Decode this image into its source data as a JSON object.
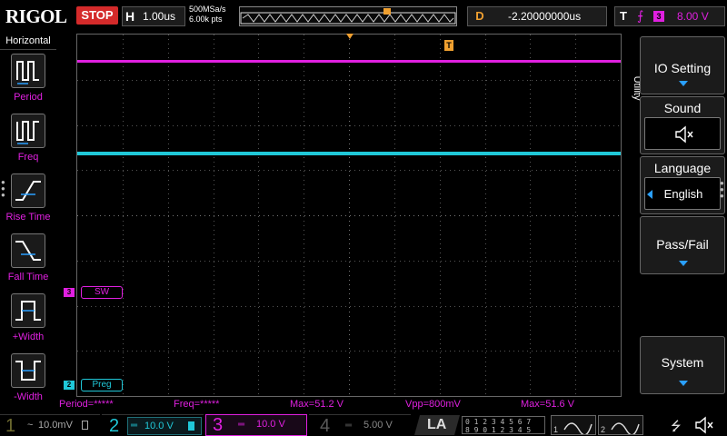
{
  "header": {
    "brand": "RIGOL",
    "run_state": "STOP",
    "horizontal_letter": "H",
    "timebase": "1.00us",
    "sample_rate": "500MSa/s",
    "memory_depth": "6.00k pts",
    "delay_letter": "D",
    "delay_value": "-2.20000000us",
    "trigger_letter": "T",
    "trigger_source": "3",
    "trigger_level": "8.00 V"
  },
  "left_menu": {
    "title": "Horizontal",
    "items": [
      {
        "label": "Period",
        "icon": "period-icon"
      },
      {
        "label": "Freq",
        "icon": "freq-icon"
      },
      {
        "label": "Rise Time",
        "icon": "rise-time-icon"
      },
      {
        "label": "Fall Time",
        "icon": "fall-time-icon"
      },
      {
        "label": "+Width",
        "icon": "positive-width-icon"
      },
      {
        "label": "-Width",
        "icon": "negative-width-icon"
      }
    ]
  },
  "right_menu": {
    "tab": "Utility",
    "io_setting": "IO Setting",
    "sound_title": "Sound",
    "language_title": "Language",
    "language_value": "English",
    "pass_fail": "Pass/Fail",
    "system": "System"
  },
  "waveforms": {
    "ch3_label": "SW",
    "ch2_label": "Preg",
    "ch3_marker": "3",
    "ch2_marker": "2",
    "trigger_marker": "T"
  },
  "measurements": {
    "period": "Period=*****",
    "freq": "Freq=*****",
    "max1": "Max=51.2 V",
    "vpp": "Vpp=800mV",
    "max2": "Max=51.6 V"
  },
  "channels": [
    {
      "num": "1",
      "scale": "10.0mV",
      "color": "#d0c020",
      "active": false
    },
    {
      "num": "2",
      "scale": "10.0 V",
      "color": "#20c8d8",
      "active": true
    },
    {
      "num": "3",
      "scale": "10.0 V",
      "color": "#e020e0",
      "active": true
    },
    {
      "num": "4",
      "scale": "5.00 V",
      "color": "#3050ff",
      "active": false
    }
  ],
  "bottom": {
    "la_label": "LA",
    "digital_row1": "0 1 2 3  4 5 6 7",
    "digital_row2": "8 9 0 1  2 3 4 5",
    "math1": "1",
    "math2": "2"
  },
  "colors": {
    "ch2": "#20c8d8",
    "ch3": "#e020e0",
    "trigger": "#f0a030",
    "stop": "#d42a2a",
    "menu_arrow": "#2aa0ff"
  }
}
